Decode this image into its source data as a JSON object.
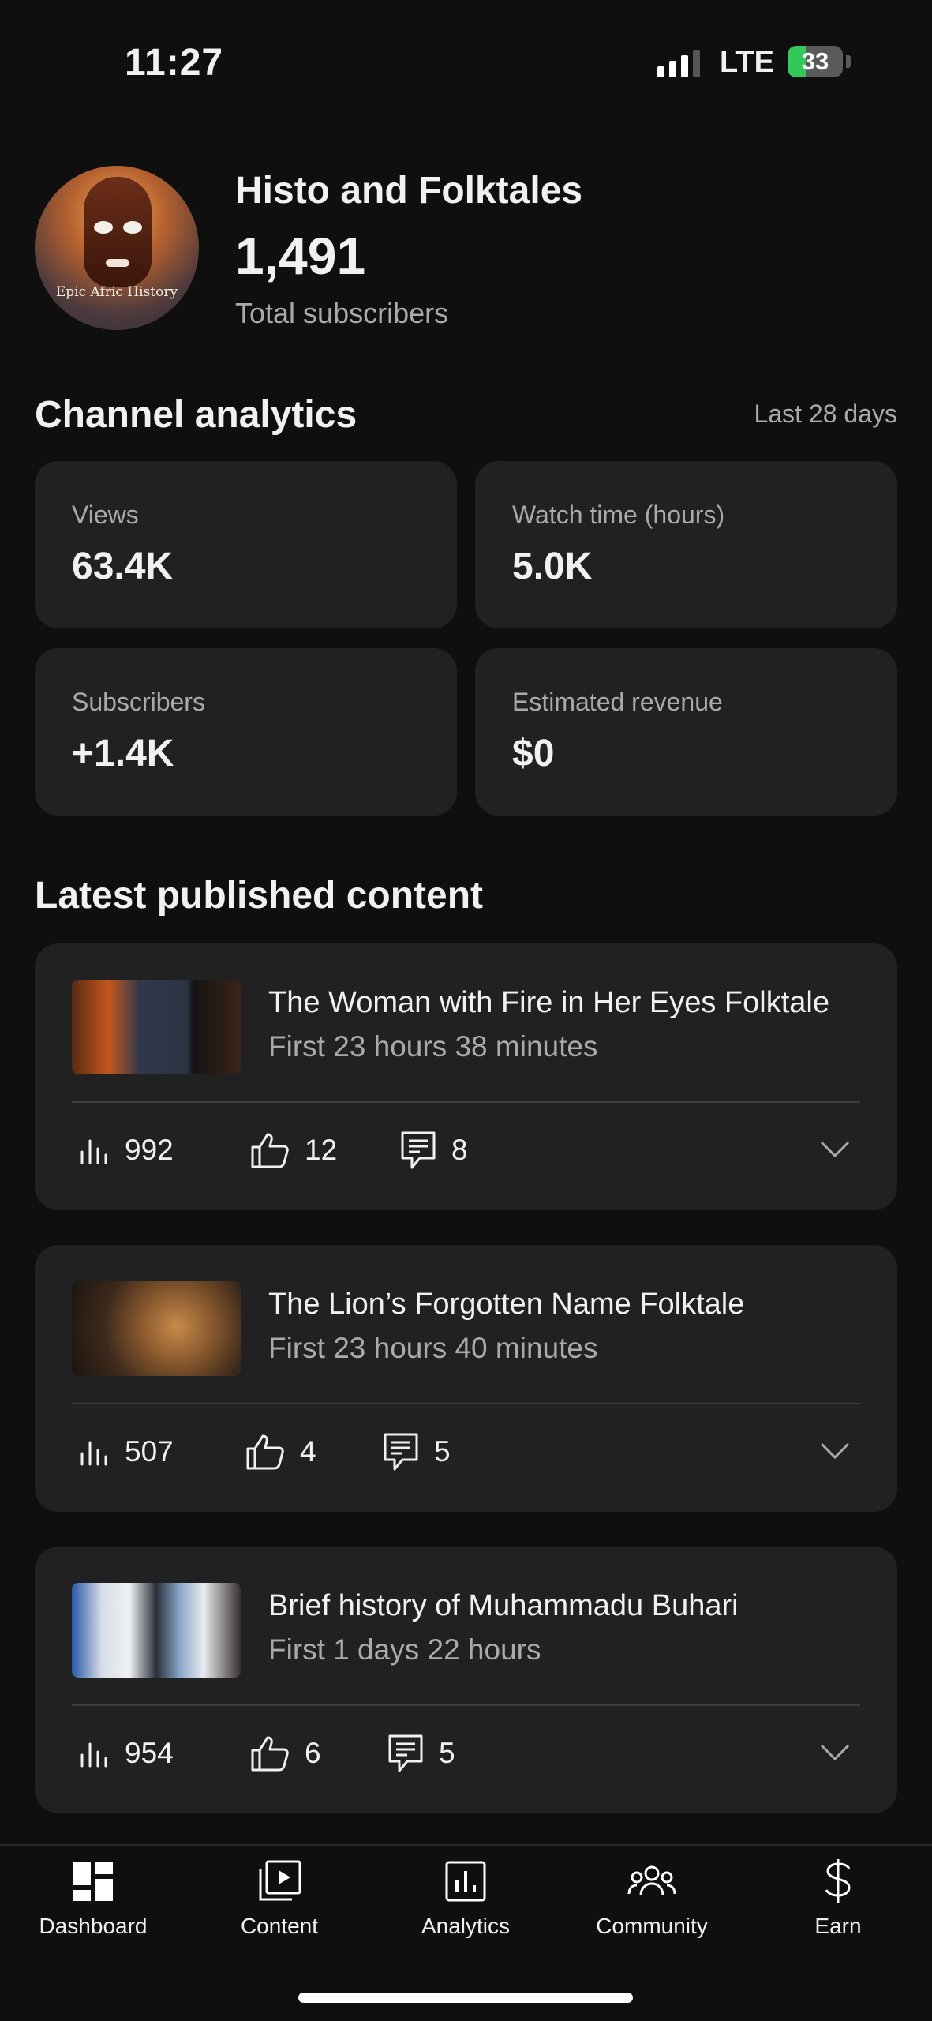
{
  "status_bar": {
    "time": "11:27",
    "network": "LTE",
    "battery": "33",
    "battery_level": 0.33
  },
  "channel": {
    "name": "Histo and Folktales",
    "subscribers": "1,491",
    "subscribers_label": "Total subscribers",
    "avatar_caption": "Epic Afric History"
  },
  "analytics": {
    "title": "Channel analytics",
    "period": "Last 28 days",
    "stats": [
      {
        "label": "Views",
        "value": "63.4K"
      },
      {
        "label": "Watch time (hours)",
        "value": "5.0K"
      },
      {
        "label": "Subscribers",
        "value": "+1.4K"
      },
      {
        "label": "Estimated revenue",
        "value": "$0"
      }
    ]
  },
  "latest": {
    "title": "Latest published content",
    "items": [
      {
        "title": "The Woman with Fire in Her Eyes Folktale",
        "subtitle": "First 23 hours 38 minutes",
        "views": "992",
        "likes": "12",
        "comments": "8"
      },
      {
        "title": "The Lion’s Forgotten Name Folktale",
        "subtitle": "First 23 hours 40 minutes",
        "views": "507",
        "likes": "4",
        "comments": "5"
      },
      {
        "title": "Brief history of Muhammadu Buhari",
        "subtitle": "First 1 days 22 hours",
        "views": "954",
        "likes": "6",
        "comments": "5"
      }
    ]
  },
  "nav": {
    "items": [
      {
        "label": "Dashboard",
        "icon": "dashboard-icon"
      },
      {
        "label": "Content",
        "icon": "content-icon"
      },
      {
        "label": "Analytics",
        "icon": "analytics-icon"
      },
      {
        "label": "Community",
        "icon": "community-icon"
      },
      {
        "label": "Earn",
        "icon": "earn-icon"
      }
    ]
  },
  "colors": {
    "background": "#0f0f0f",
    "card": "#212121",
    "secondary_text": "#aaaaaa",
    "battery": "#34c759"
  }
}
